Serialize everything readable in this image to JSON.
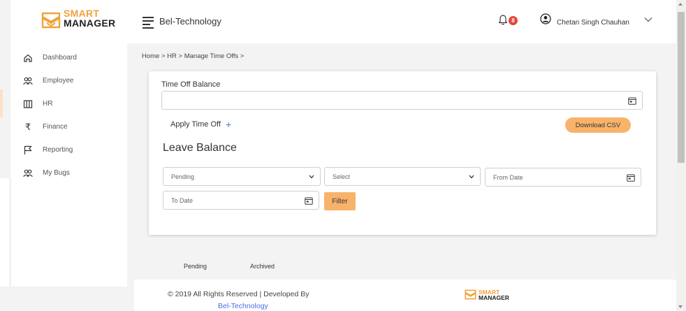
{
  "logo": {
    "line1": "SMART",
    "line2": "MANAGER"
  },
  "sidebar": {
    "items": [
      {
        "label": "Dashboard",
        "icon": "home-icon"
      },
      {
        "label": "Employee",
        "icon": "users-icon"
      },
      {
        "label": "HR",
        "icon": "columns-icon"
      },
      {
        "label": "Finance",
        "icon": "rupee-icon"
      },
      {
        "label": "Reporting",
        "icon": "flag-icon"
      },
      {
        "label": "My Bugs",
        "icon": "users-icon"
      }
    ]
  },
  "header": {
    "title": "Bel-Technology",
    "notification_count": "8",
    "user_name": "Chetan Singh Chauhan"
  },
  "breadcrumb": "Home >  HR >  Manage Time Offs >",
  "card": {
    "time_off_label": "Time Off Balance",
    "time_off_value": "",
    "apply_label": "Apply Time Off",
    "apply_plus": "+",
    "download_label": "Download CSV",
    "leave_title": "Leave Balance",
    "status_selected": "Pending",
    "type_selected": "Select",
    "from_placeholder": "From Date",
    "to_placeholder": "To Date",
    "filter_label": "Filter"
  },
  "tabs": [
    {
      "label": "Pending"
    },
    {
      "label": "Archived"
    }
  ],
  "footer": {
    "copyright": "© 2019 All Rights Reserved | Developed By",
    "developer": "Bel-Technology"
  },
  "colors": {
    "accent": "#f8b36a",
    "link": "#4a6ee0",
    "badge": "#e5453b"
  }
}
